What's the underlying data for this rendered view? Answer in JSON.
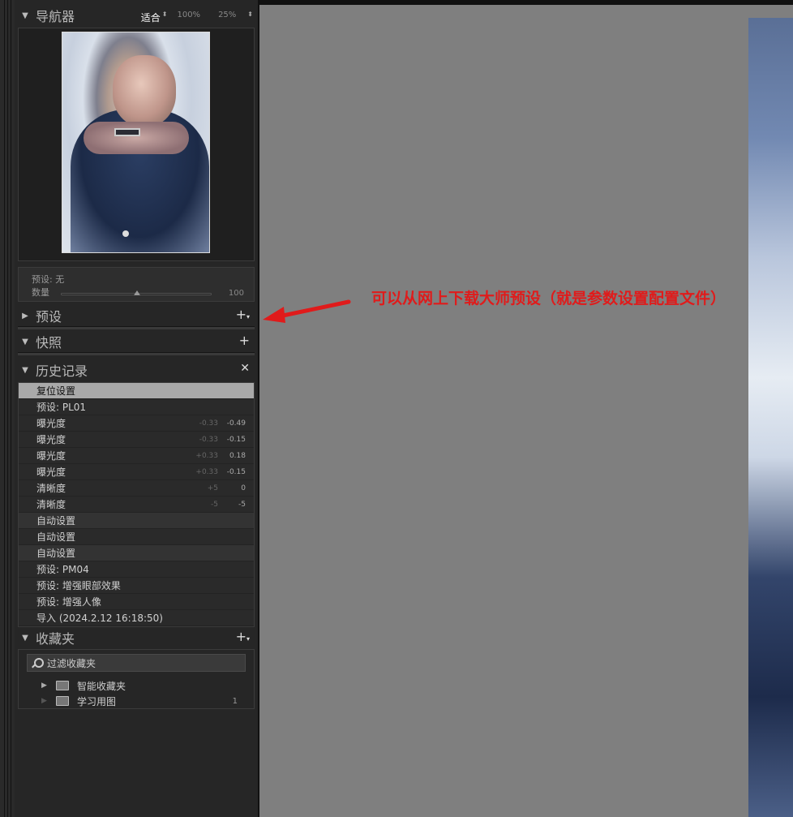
{
  "navigator": {
    "title": "导航器",
    "zoom_options": [
      "适合",
      "100%",
      "25%"
    ],
    "selected_zoom": "适合"
  },
  "quick_preset": {
    "preset_label": "预设:",
    "preset_value": "无",
    "amount_label": "数量",
    "amount_value": "100",
    "amount_fraction": 0.5
  },
  "presets": {
    "title": "预设"
  },
  "snapshots": {
    "title": "快照"
  },
  "history": {
    "title": "历史记录",
    "items": [
      {
        "label": "复位设置",
        "v1": "",
        "v2": ""
      },
      {
        "label": "预设: PL01",
        "v1": "",
        "v2": ""
      },
      {
        "label": "曝光度",
        "v1": "-0.33",
        "v2": "-0.49"
      },
      {
        "label": "曝光度",
        "v1": "-0.33",
        "v2": "-0.15"
      },
      {
        "label": "曝光度",
        "v1": "+0.33",
        "v2": "0.18"
      },
      {
        "label": "曝光度",
        "v1": "+0.33",
        "v2": "-0.15"
      },
      {
        "label": "清晰度",
        "v1": "+5",
        "v2": "0"
      },
      {
        "label": "清晰度",
        "v1": "-5",
        "v2": "-5"
      },
      {
        "label": "自动设置",
        "v1": "",
        "v2": ""
      },
      {
        "label": "自动设置",
        "v1": "",
        "v2": ""
      },
      {
        "label": "自动设置",
        "v1": "",
        "v2": ""
      },
      {
        "label": "预设: PM04",
        "v1": "",
        "v2": ""
      },
      {
        "label": "预设: 增强眼部效果",
        "v1": "",
        "v2": ""
      },
      {
        "label": "预设: 增强人像",
        "v1": "",
        "v2": ""
      },
      {
        "label": "导入 (2024.2.12 16:18:50)",
        "v1": "",
        "v2": ""
      }
    ]
  },
  "collections": {
    "title": "收藏夹",
    "filter_placeholder": "过滤收藏夹",
    "items": [
      {
        "label": "智能收藏夹",
        "count": ""
      },
      {
        "label": "学习用图",
        "count": "1"
      }
    ]
  },
  "annotation": {
    "text": "可以从网上下载大师预设（就是参数设置配置文件）",
    "color": "#e01b1b"
  }
}
